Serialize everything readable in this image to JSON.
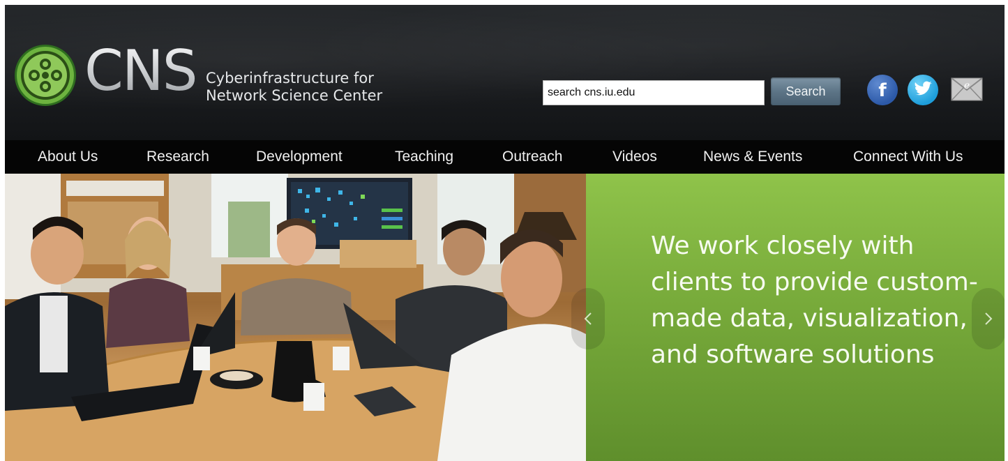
{
  "header": {
    "logo_text": "CNS",
    "logo_subtitle_line1": "Cyberinfrastructure for",
    "logo_subtitle_line2": "Network Science Center",
    "search": {
      "value": "search cns.iu.edu",
      "button_label": "Search"
    },
    "social": {
      "facebook_icon": "facebook-icon",
      "twitter_icon": "twitter-icon",
      "email_icon": "email-icon",
      "facebook_glyph": "f",
      "email_glyph": "e"
    }
  },
  "nav": {
    "items": [
      {
        "label": "About Us"
      },
      {
        "label": "Research"
      },
      {
        "label": "Development"
      },
      {
        "label": "Teaching"
      },
      {
        "label": "Outreach"
      },
      {
        "label": "Videos"
      },
      {
        "label": "News & Events"
      },
      {
        "label": "Connect With Us"
      }
    ]
  },
  "hero": {
    "headline": "We work closely with clients to provide custom-made data, visualization, and software solutions",
    "green_color": "#7aad3c"
  },
  "colors": {
    "header_bg": "#1b1d20",
    "nav_bg": "#050505",
    "logo_green": "#6db33f",
    "search_button": "#5d7587"
  }
}
